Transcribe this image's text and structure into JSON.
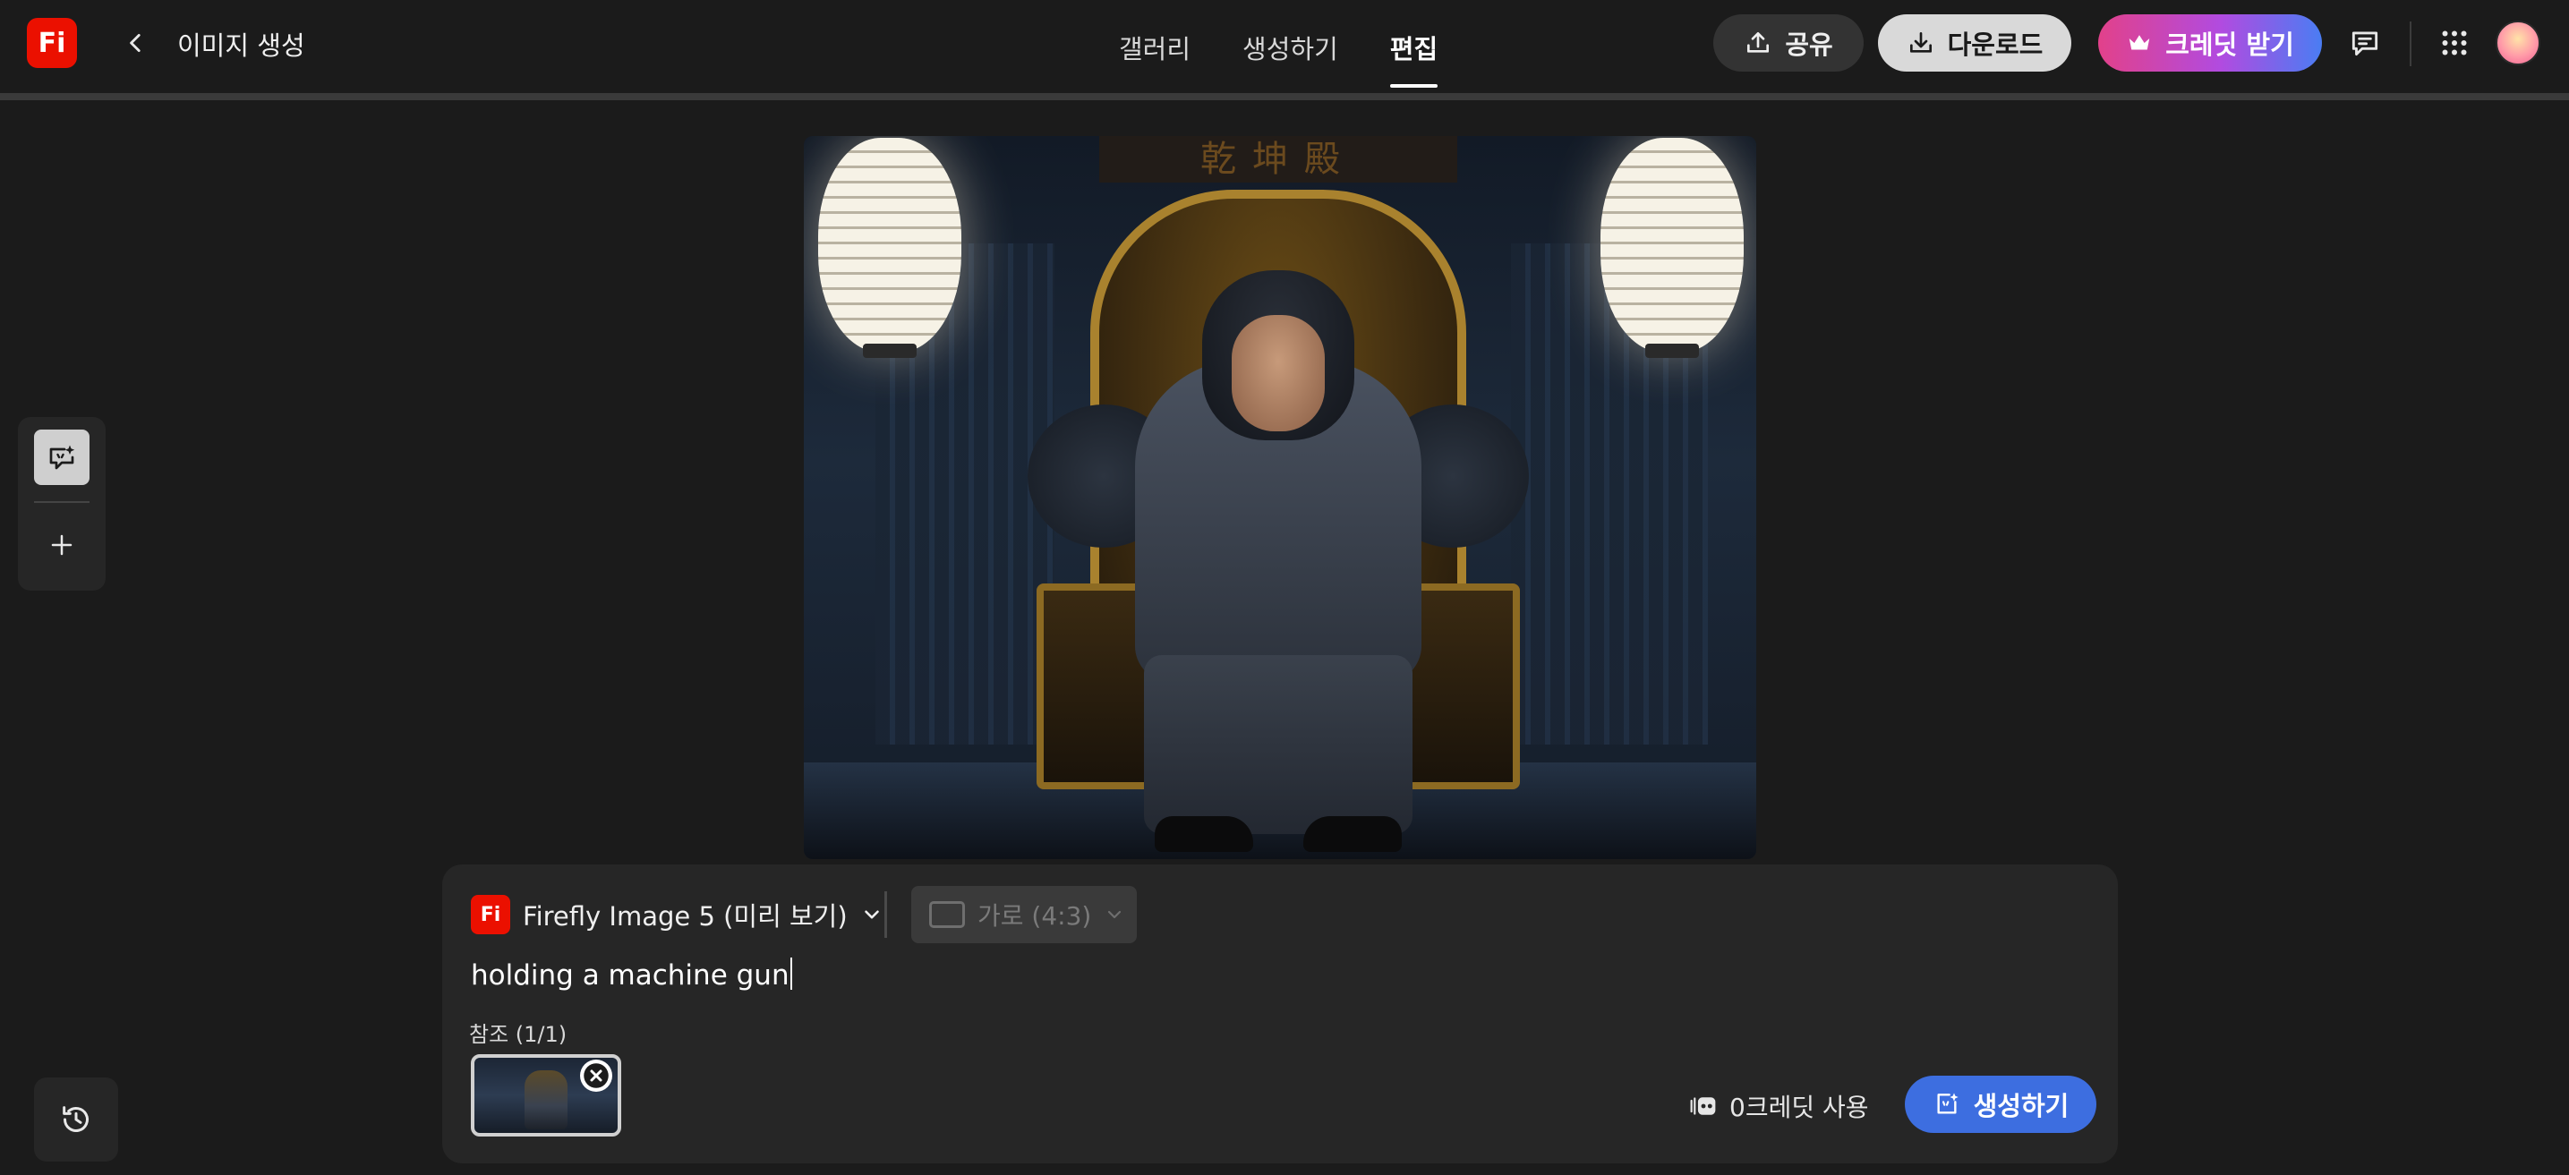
{
  "header": {
    "logo_text": "Fi",
    "title": "이미지 생성",
    "tabs": [
      {
        "label": "갤러리",
        "active": false
      },
      {
        "label": "생성하기",
        "active": false
      },
      {
        "label": "편집",
        "active": true
      }
    ],
    "share_label": "공유",
    "download_label": "다운로드",
    "credits_label": "크레딧 받기",
    "icons": [
      "upload-icon",
      "download-icon",
      "crown-icon",
      "feedback-icon",
      "apps-grid-icon"
    ]
  },
  "tool_rail": {
    "tools": [
      "generative-edit-icon",
      "add-icon"
    ],
    "history_icon": "history-icon"
  },
  "canvas": {
    "image_description": "",
    "sign_text": "乾坤殿"
  },
  "prompt_panel": {
    "model_logo_text": "Fi",
    "model_label": "Firefly Image 5 (미리 보기)",
    "aspect_ratio_label": "가로 (4:3)",
    "prompt_value": "holding a machine gun",
    "reference_label": "참조 (1/1)",
    "credit_usage_label": "0크레딧 사용",
    "generate_label": "생성하기"
  },
  "colors": {
    "background": "#1b1b1b",
    "panel": "#262626",
    "generate_button": "#3d6ee0",
    "brand_red": "#eb1000"
  }
}
